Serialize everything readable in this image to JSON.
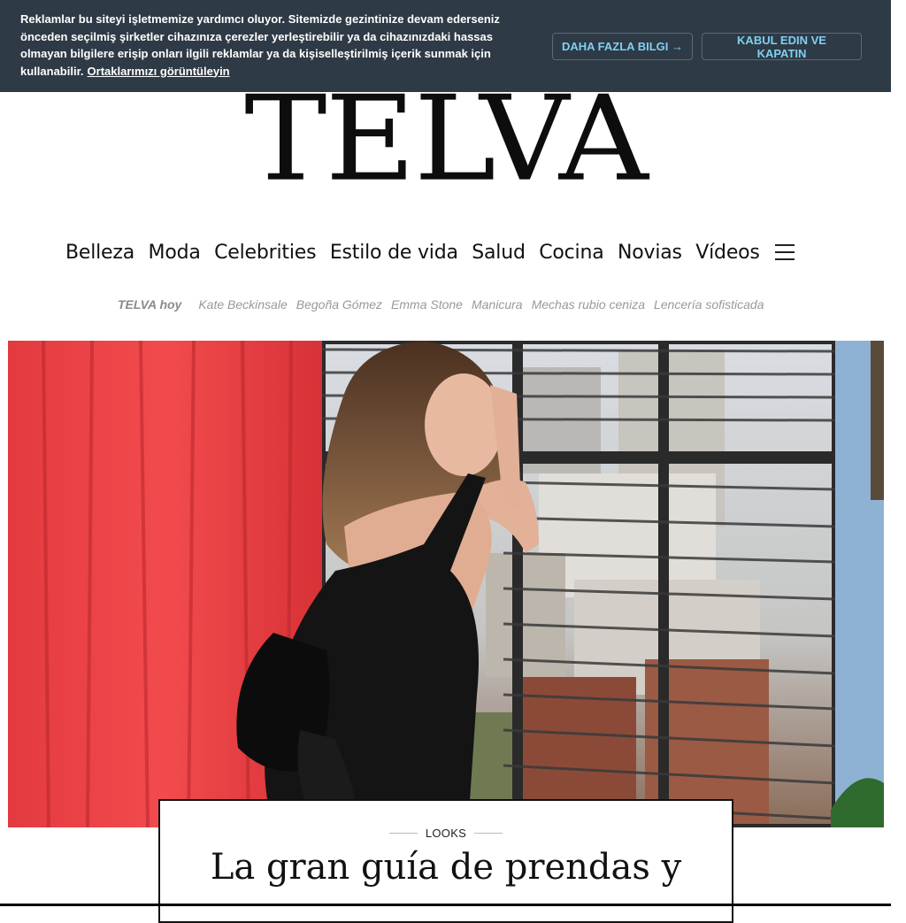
{
  "cookie_banner": {
    "text": "Reklamlar bu siteyi işletmemize yardımcı oluyor. Sitemizde gezintinize devam ederseniz önceden seçilmiş şirketler cihazınıza çerezler yerleştirebilir ya da cihazınızdaki hassas olmayan bilgilere erişip onları ilgili reklamlar ya da kişiselleştirilmiş içerik sunmak için kullanabilir.",
    "partners_link": "Ortaklarımızı görüntüleyin",
    "more_info_button": "DAHA FAZLA BILGI →",
    "accept_button": "KABUL EDIN VE KAPATIN",
    "colors": {
      "background": "#2e3a45",
      "button_text": "#7fd0f3"
    }
  },
  "logo": {
    "text": "TELVA"
  },
  "nav": {
    "items": [
      "Belleza",
      "Moda",
      "Celebrities",
      "Estilo de vida",
      "Salud",
      "Cocina",
      "Novias",
      "Vídeos"
    ],
    "menu_icon": "hamburger-menu-icon"
  },
  "trending": {
    "label": "TELVA hoy",
    "items": [
      "Kate Beckinsale",
      "Begoña Gómez",
      "Emma Stone",
      "Manicura",
      "Mechas rubio ceniza",
      "Lencería sofisticada"
    ]
  },
  "hero": {
    "kicker": "LOOKS",
    "headline": "La gran guía de prendas y"
  }
}
